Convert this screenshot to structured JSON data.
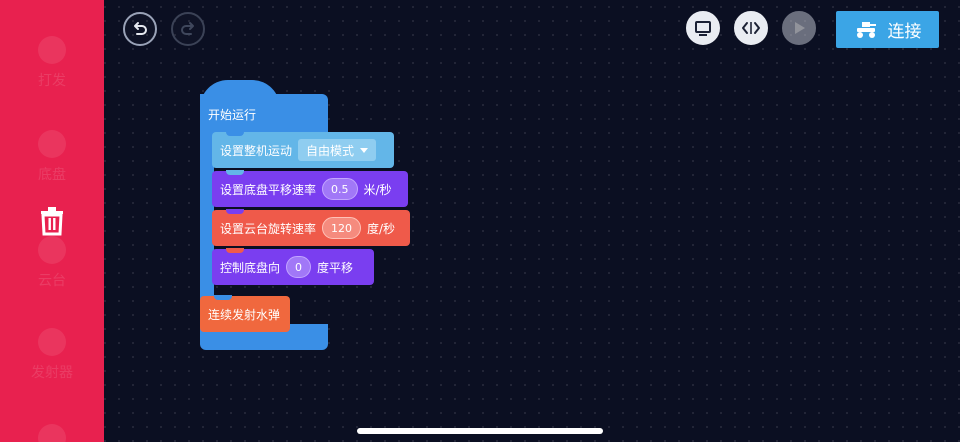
{
  "sidebar": {
    "categories": [
      {
        "label": "打发"
      },
      {
        "label": "底盘"
      },
      {
        "label": "云台"
      },
      {
        "label": "发射器"
      }
    ]
  },
  "toolbar": {
    "connect_label": "连接"
  },
  "blocks": {
    "hat_label": "开始运行",
    "mode_label": "设置整机运动",
    "mode_value": "自由模式",
    "chassis_speed_label": "设置底盘平移速率",
    "chassis_speed_value": "0.5",
    "chassis_speed_unit": "米/秒",
    "gimbal_label": "设置云台旋转速率",
    "gimbal_value": "120",
    "gimbal_unit": "度/秒",
    "translate_label": "控制底盘向",
    "translate_value": "0",
    "translate_unit": "度平移",
    "fire_label": "连续发射水弹"
  },
  "colors": {
    "sidebar": "#e8214f",
    "event": "#3a8fe6",
    "mode": "#63b6e8",
    "chassis": "#7a3ef0",
    "gimbal": "#ef5a4a",
    "blaster": "#f0683e",
    "connect": "#3ba5e6"
  }
}
